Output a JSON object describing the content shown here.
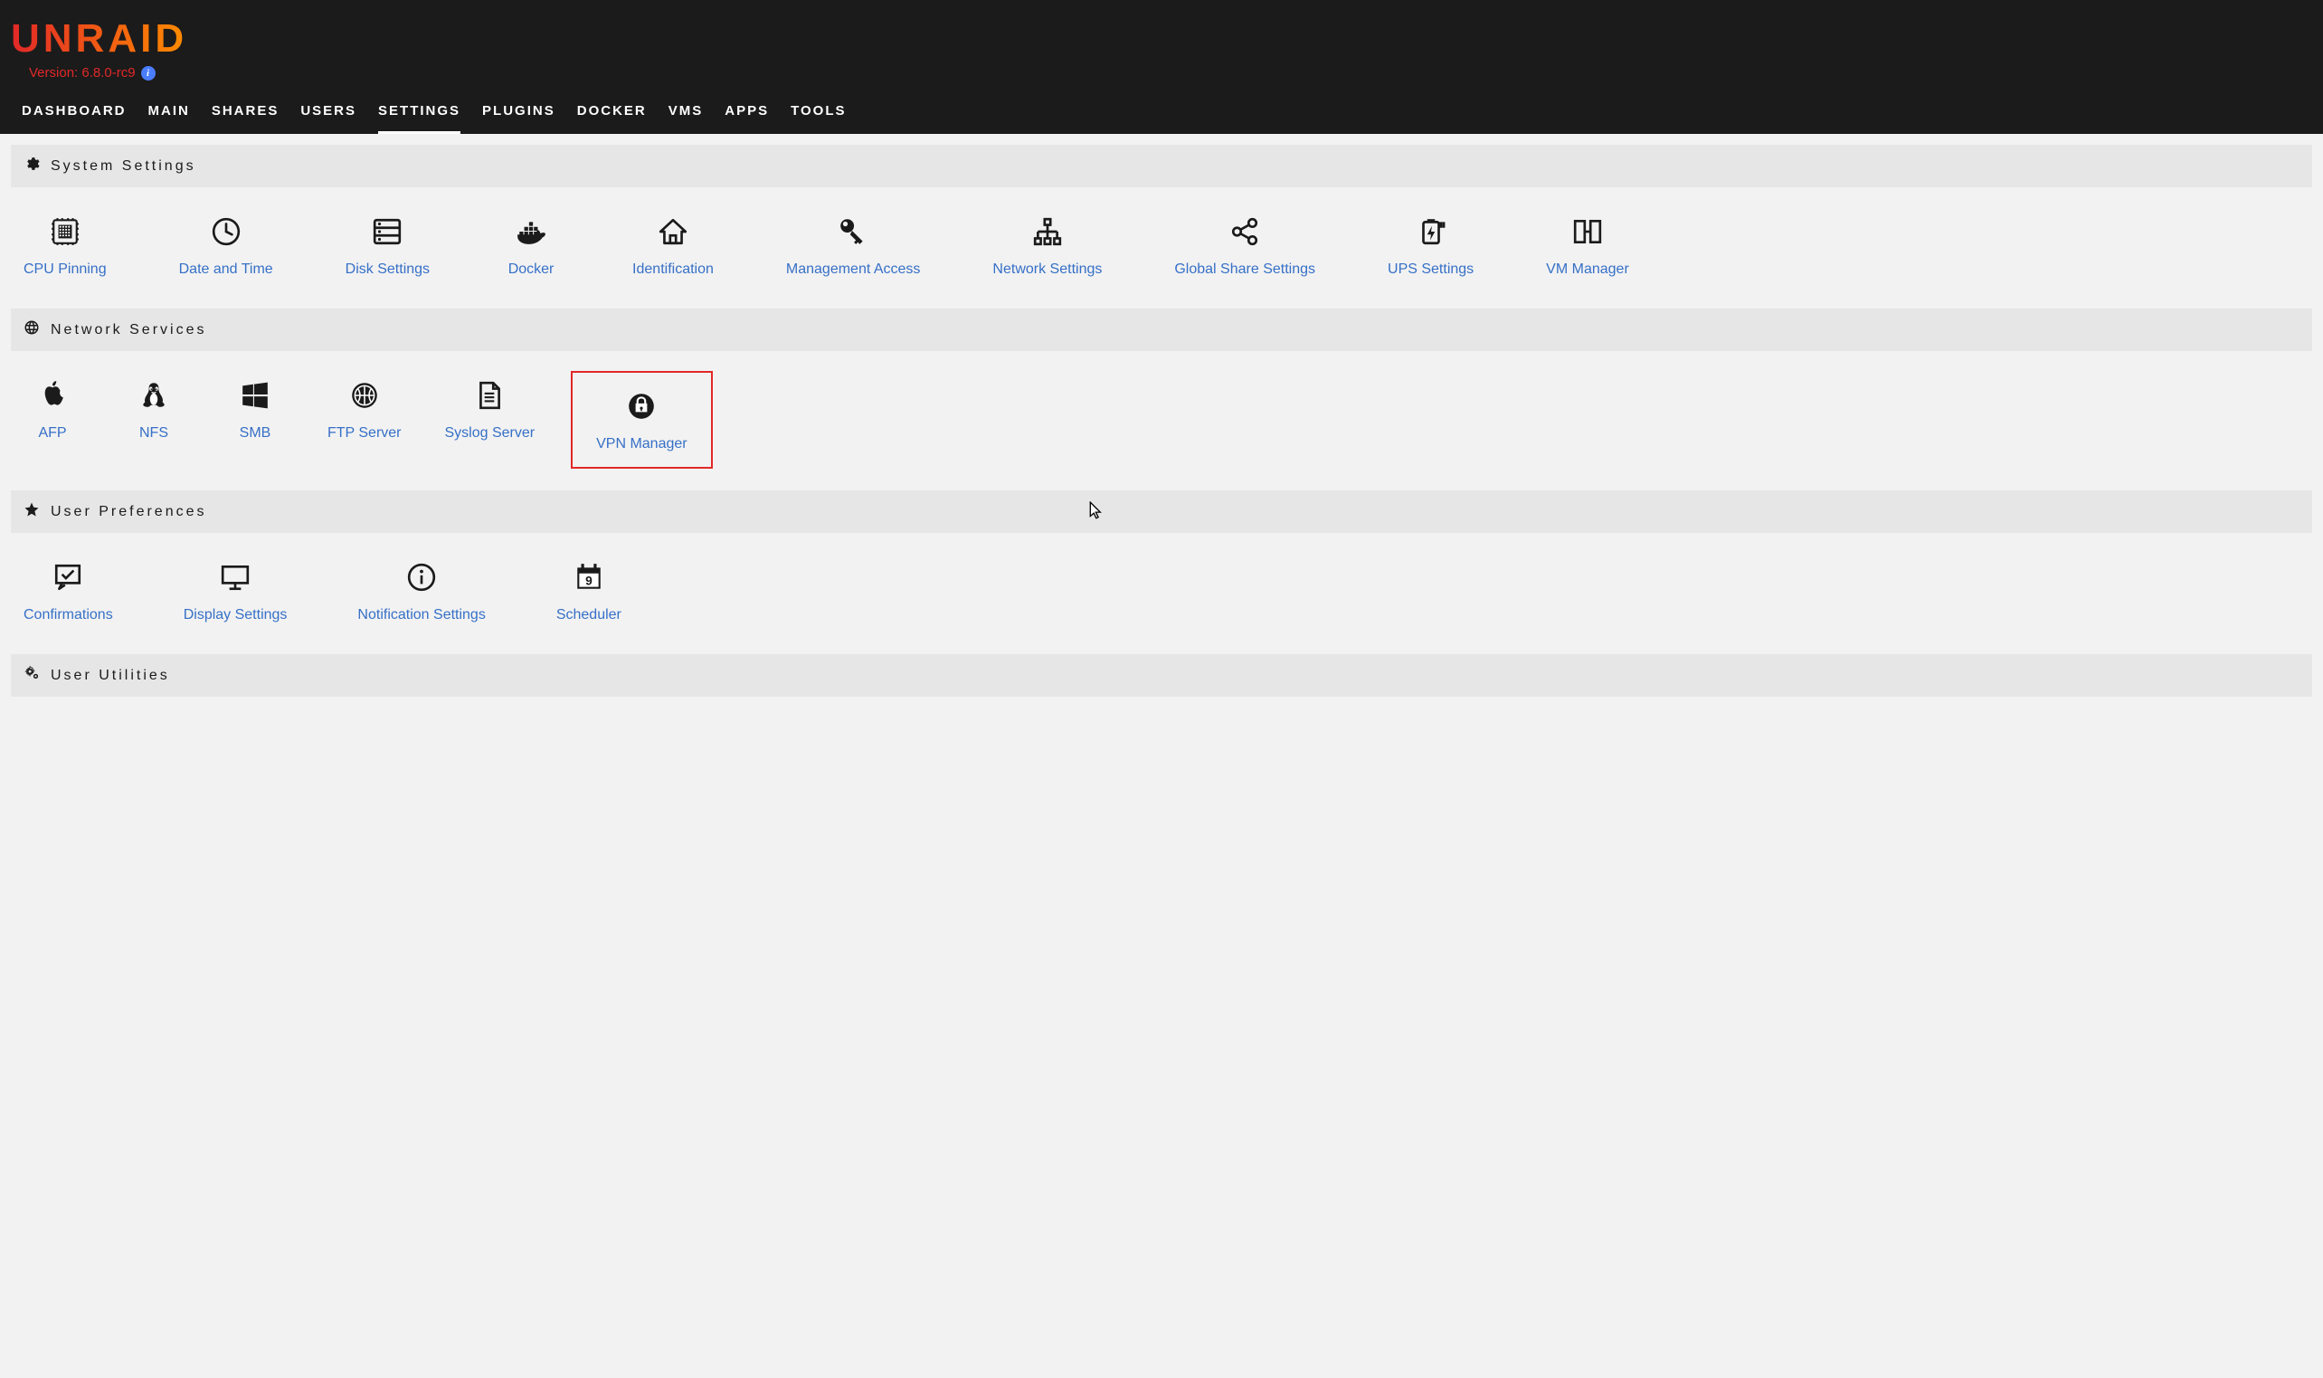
{
  "brand": "UNRAID",
  "version": "Version: 6.8.0-rc9",
  "nav": {
    "items": [
      "DASHBOARD",
      "MAIN",
      "SHARES",
      "USERS",
      "SETTINGS",
      "PLUGINS",
      "DOCKER",
      "VMS",
      "APPS",
      "TOOLS"
    ],
    "active": "SETTINGS"
  },
  "sections": {
    "system": {
      "title": "System Settings",
      "tiles": [
        "CPU Pinning",
        "Date and Time",
        "Disk Settings",
        "Docker",
        "Identification",
        "Management Access",
        "Network Settings",
        "Global Share Settings",
        "UPS Settings",
        "VM Manager"
      ]
    },
    "network": {
      "title": "Network Services",
      "tiles": [
        "AFP",
        "NFS",
        "SMB",
        "FTP Server",
        "Syslog Server",
        "VPN Manager"
      ],
      "highlight": "VPN Manager"
    },
    "prefs": {
      "title": "User Preferences",
      "tiles": [
        "Confirmations",
        "Display Settings",
        "Notification Settings",
        "Scheduler"
      ]
    },
    "util": {
      "title": "User Utilities"
    }
  },
  "icons": {
    "CPU Pinning": "cpu",
    "Date and Time": "clock",
    "Disk Settings": "disk",
    "Docker": "docker",
    "Identification": "house",
    "Management Access": "key",
    "Network Settings": "net",
    "Global Share Settings": "share",
    "UPS Settings": "ups",
    "VM Manager": "vm",
    "AFP": "apple",
    "NFS": "linux",
    "SMB": "windows",
    "FTP Server": "ftp",
    "Syslog Server": "file",
    "VPN Manager": "vpn",
    "Confirmations": "confirm",
    "Display Settings": "display",
    "Notification Settings": "info",
    "Scheduler": "cal"
  }
}
